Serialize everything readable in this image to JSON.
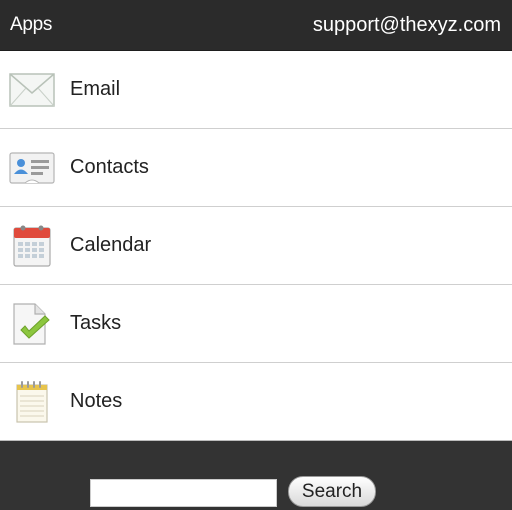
{
  "header": {
    "title": "Apps",
    "account": "support@thexyz.com"
  },
  "apps": [
    {
      "label": "Email",
      "icon": "envelope-icon"
    },
    {
      "label": "Contacts",
      "icon": "contact-card-icon"
    },
    {
      "label": "Calendar",
      "icon": "calendar-icon"
    },
    {
      "label": "Tasks",
      "icon": "task-check-icon"
    },
    {
      "label": "Notes",
      "icon": "notepad-icon"
    }
  ],
  "search": {
    "value": "",
    "placeholder": "",
    "button_label": "Search"
  },
  "colors": {
    "header_bg": "#2b2b2b",
    "footer_bg": "#333333",
    "calendar_red": "#e04a3c",
    "check_green": "#8cc63f",
    "contact_blue": "#4a90d9"
  }
}
